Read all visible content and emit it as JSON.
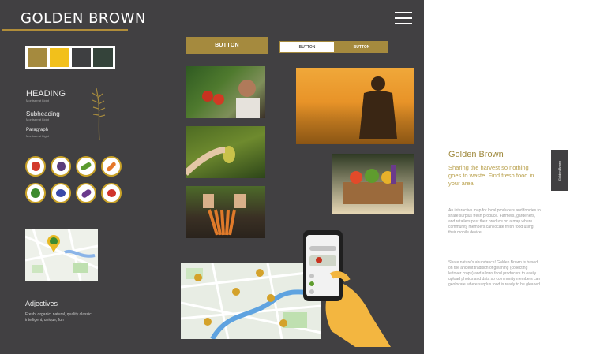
{
  "brand": {
    "title": "GOLDEN BROWN"
  },
  "palette": [
    "#a58a3e",
    "#f2c01b",
    "#3e3f41",
    "#34433a"
  ],
  "typography": {
    "heading": "HEADING",
    "heading_font": "Montserrat Light",
    "subheading": "Subheading",
    "subheading_font": "Montserrat Light",
    "paragraph": "Paragraph",
    "paragraph_font": "Montserrat Light"
  },
  "produce_icons": [
    "strawberry-icon",
    "blackberry-icon",
    "pea-pod-icon",
    "carrot-icon",
    "broccoli-icon",
    "blueberry-icon",
    "eggplant-icon",
    "cherry-icon"
  ],
  "adjectives": {
    "heading": "Adjectives",
    "text": "Fresh, organic, natural, quality classic, intelligent, unique, fun"
  },
  "buttons": {
    "primary": "BUTTON",
    "group_left": "BUTTON",
    "group_right": "BUTTON"
  },
  "panel": {
    "title": "Golden Brown",
    "tagline": "Sharing the harvest so nothing goes to waste. Find fresh food in your area",
    "p1": "An interactive map for local producers and foodies to share surplus fresh produce. Farmers, gardeners, and retailers post their produce on a map where community members can locate fresh food using their mobile device.",
    "p2": "Share nature's abundance! Golden Brown is based on the ancient tradition of gleaning (collecting leftover crops) and allows food producers to easily upload photos and data so community members can geolocate where surplus food is ready to be gleaned.",
    "tab_label": "Golden Brown"
  }
}
